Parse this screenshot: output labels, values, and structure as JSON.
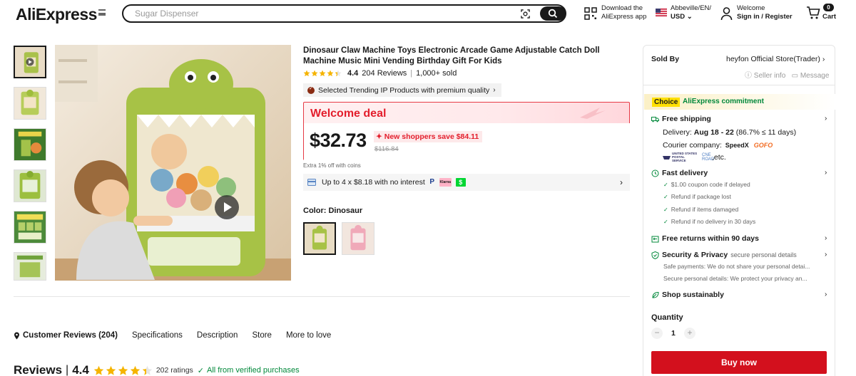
{
  "header": {
    "logo": "AliExpress",
    "search_placeholder": "Sugar Dispenser",
    "download_line1": "Download the",
    "download_line2": "AliExpress app",
    "locale_line1": "Abbeville/EN/",
    "locale_line2": "USD",
    "welcome_line1": "Welcome",
    "welcome_line2": "Sign in / Register",
    "cart_count": "0",
    "cart_label": "Cart"
  },
  "product": {
    "title": "Dinosaur Claw Machine Toys Electronic Arcade Game Adjustable Catch Doll Machine Music Mini Vending Birthday Gift For Kids",
    "rating": "4.4",
    "stars": 4.4,
    "reviews": "204 Reviews",
    "sold": "1,000+ sold",
    "trending": "Selected Trending IP Products with premium quality",
    "welcome_deal": "Welcome deal",
    "price": "$32.73",
    "save_text": "New shoppers save $84.11",
    "old_price": "$116.84",
    "coins_note": "Extra 1% off with coins",
    "installments": "Up to 4 x $8.18 with no interest",
    "color_label": "Color: Dinosaur"
  },
  "tabs": {
    "customer_reviews": "Customer Reviews (204)",
    "specifications": "Specifications",
    "description": "Description",
    "store": "Store",
    "more": "More to love"
  },
  "reviews_section": {
    "title": "Reviews",
    "rating": "4.4",
    "ratings_count": "202 ratings",
    "verified": "All from verified purchases"
  },
  "seller": {
    "sold_by": "Sold By",
    "store_name": "heyfon Official Store(Trader)",
    "seller_info": "Seller info",
    "message": "Message"
  },
  "commitment": {
    "choice": "Choice",
    "text": "AliExpress commitment",
    "free_shipping": "Free shipping",
    "delivery_prefix": "Delivery:",
    "delivery_dates": "Aug 18 - 22",
    "delivery_suffix": "(86.7% ≤ 11 days)",
    "courier_label": "Courier company:",
    "courier_speedx": "SpeedX",
    "courier_gofo": "GOFO",
    "usps": "UNITED STATES POSTAL SERVICE",
    "etc": ",etc.",
    "fast_delivery": "Fast delivery",
    "fast_items": [
      "$1.00 coupon code if delayed",
      "Refund if package lost",
      "Refund if items damaged",
      "Refund if no delivery in 30 days"
    ],
    "free_returns": "Free returns within 90 days",
    "security": "Security & Privacy",
    "security_note": "secure personal details",
    "safe_payments": "Safe payments: We do not share your personal detai...",
    "secure_details": "Secure personal details: We protect your privacy an...",
    "shop_sustainably": "Shop sustainably"
  },
  "purchase": {
    "quantity_label": "Quantity",
    "quantity": "1",
    "buy_now": "Buy now"
  },
  "colors": {
    "brand_red": "#d3101d",
    "welcome_red": "#e31e2c",
    "verified_green": "#00883a",
    "choice_yellow": "#ffdf00"
  }
}
